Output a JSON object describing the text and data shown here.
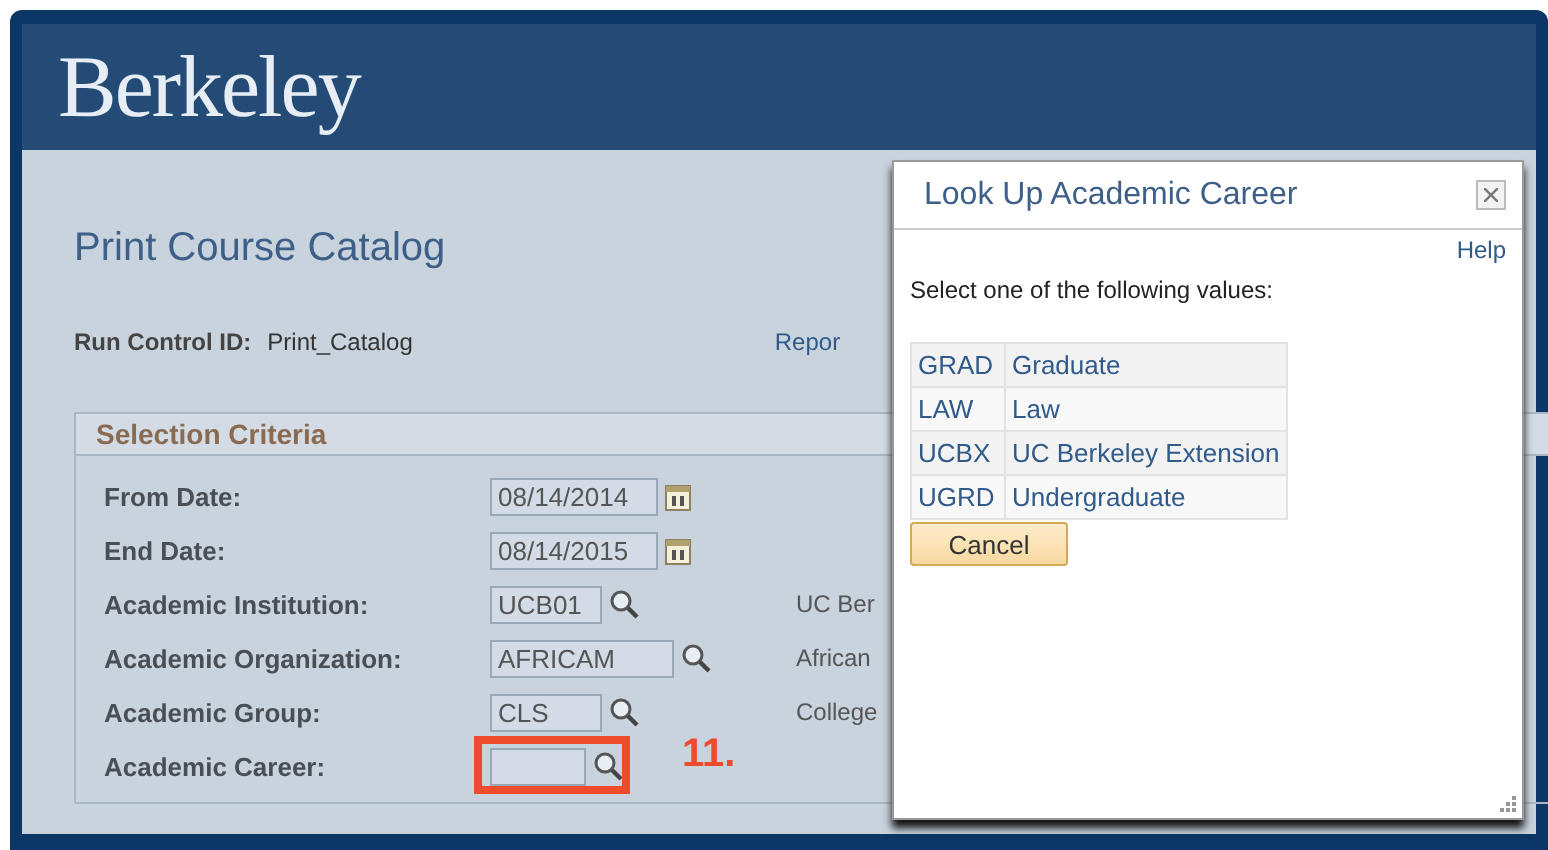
{
  "header": {
    "logo": "Berkeley"
  },
  "page": {
    "title": "Print Course Catalog",
    "run_control": {
      "label": "Run Control ID:",
      "value": "Print_Catalog"
    },
    "report_link": "Repor"
  },
  "selection_criteria": {
    "title": "Selection Criteria",
    "fields": [
      {
        "label": "From Date:",
        "kind": "date",
        "value": "08/14/2014"
      },
      {
        "label": "End Date:",
        "kind": "date",
        "value": "08/14/2015"
      },
      {
        "label": "Academic Institution:",
        "kind": "lookup",
        "value": "UCB01",
        "description": "UC Ber"
      },
      {
        "label": "Academic Organization:",
        "kind": "lookup",
        "value": "AFRICAM",
        "description": "African"
      },
      {
        "label": "Academic Group:",
        "kind": "lookup",
        "value": "CLS",
        "description": "College"
      },
      {
        "label": "Academic Career:",
        "kind": "lookup",
        "callout": "11."
      }
    ]
  },
  "dialog": {
    "title": "Look Up Academic Career",
    "help_link": "Help",
    "instruction": "Select one of the following values:",
    "values": [
      {
        "code": "GRAD",
        "description": "Graduate"
      },
      {
        "code": "LAW",
        "description": "Law"
      },
      {
        "code": "UCBX",
        "description": "UC Berkeley Extension"
      },
      {
        "code": "UGRD",
        "description": "Undergraduate"
      }
    ],
    "cancel": "Cancel"
  }
}
